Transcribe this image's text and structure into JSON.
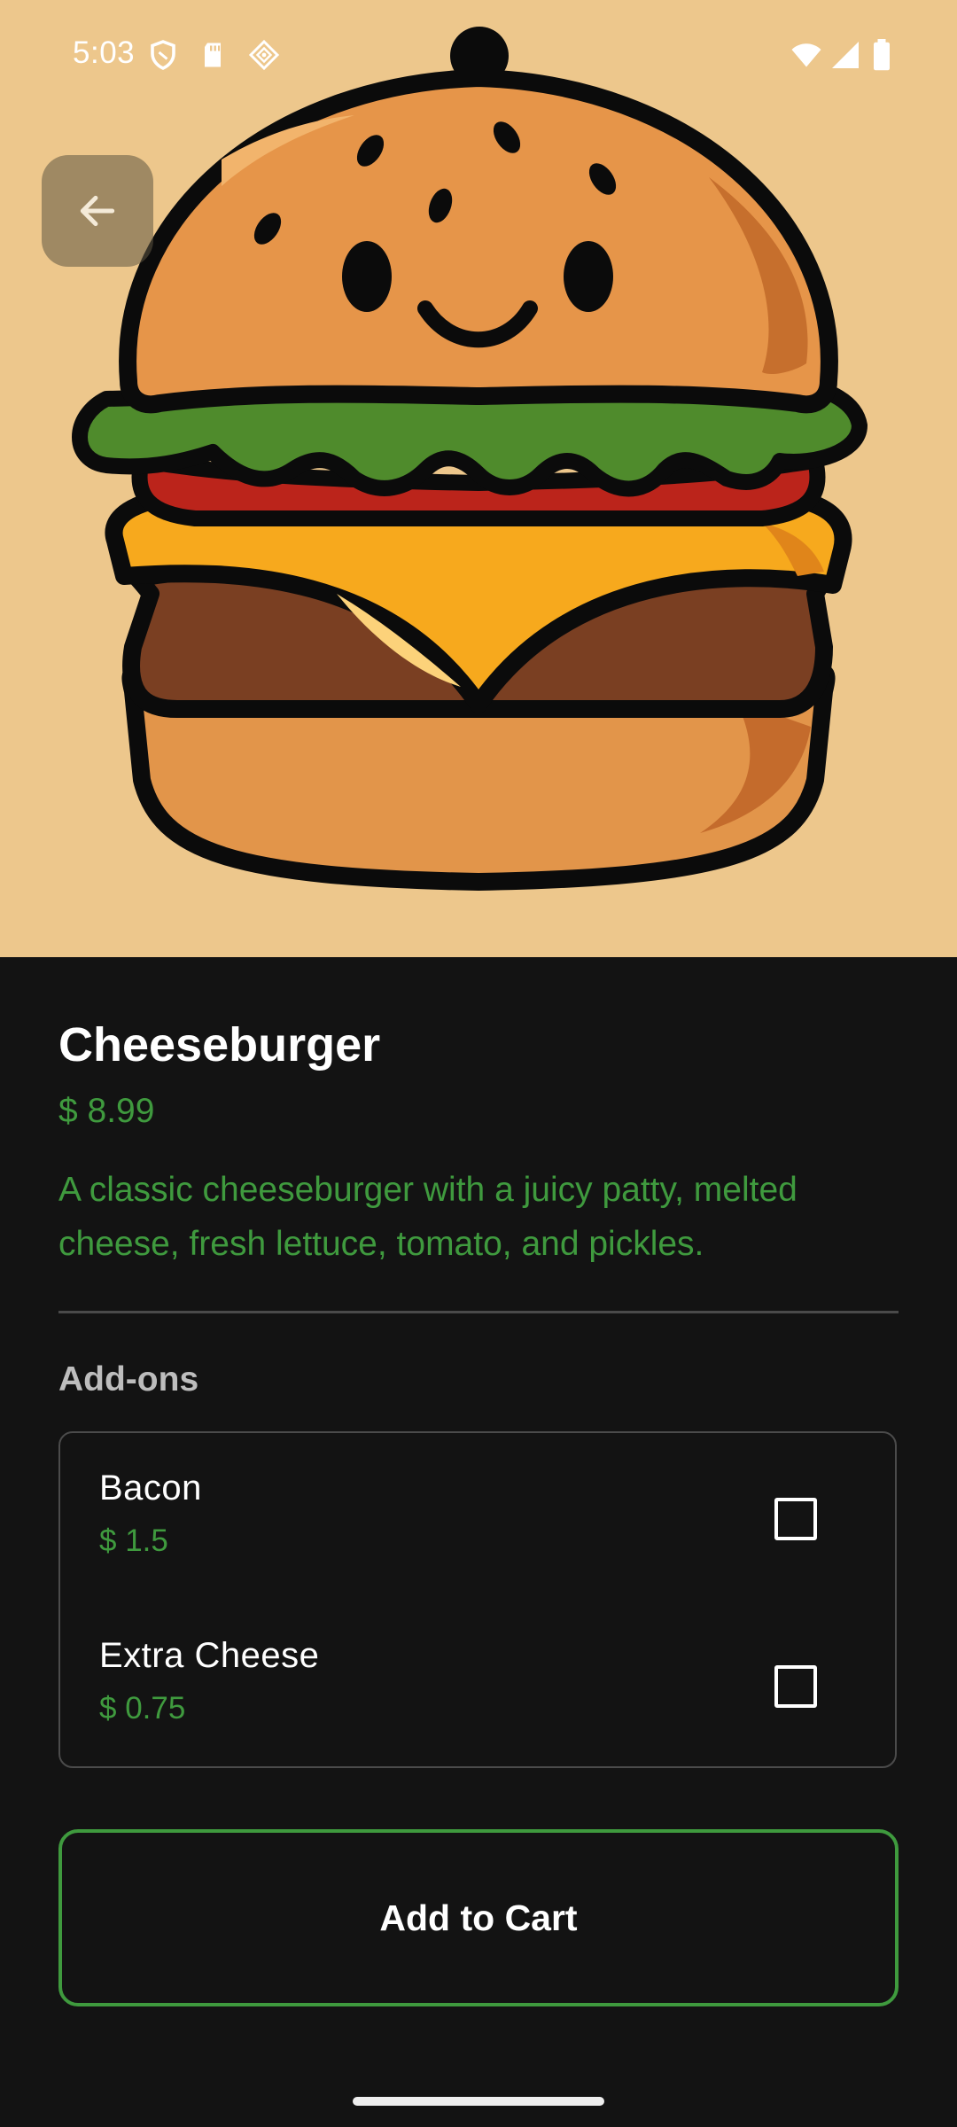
{
  "status_bar": {
    "time": "5:03",
    "left_icons": [
      "shield-icon",
      "sd-card-icon",
      "diamond-grid-icon"
    ],
    "right_icons": [
      "wifi-icon",
      "signal-icon",
      "battery-icon"
    ]
  },
  "hero": {
    "image": "cheeseburger-illustration",
    "background_color": "#edc78c",
    "back_icon": "arrow-left-icon"
  },
  "product": {
    "name": "Cheeseburger",
    "price": "$ 8.99",
    "description": "A classic cheeseburger with a juicy patty, melted cheese, fresh lettuce, tomato, and pickles."
  },
  "addons": {
    "title": "Add-ons",
    "items": [
      {
        "name": "Bacon",
        "price": "$ 1.5",
        "checked": false
      },
      {
        "name": "Extra Cheese",
        "price": "$ 0.75",
        "checked": false
      }
    ]
  },
  "actions": {
    "add_to_cart_label": "Add to Cart"
  },
  "colors": {
    "accent": "#3f9a3e",
    "background": "#131313",
    "hero_background": "#edc78c"
  }
}
